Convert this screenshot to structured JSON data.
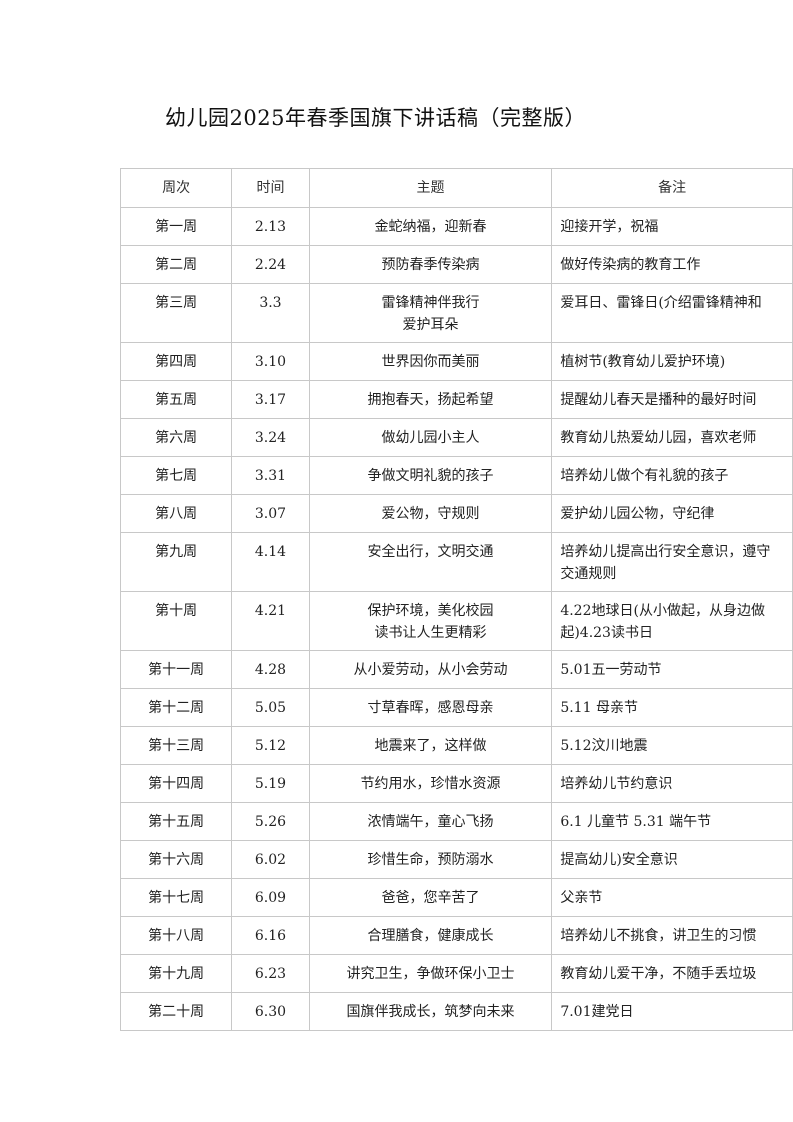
{
  "document": {
    "title": "幼儿园2025年春季国旗下讲话稿（完整版）"
  },
  "table": {
    "headers": {
      "week": "周次",
      "date": "时间",
      "theme": "主题",
      "note": "备注"
    },
    "rows": [
      {
        "week": "第一周",
        "date": "2.13",
        "theme": [
          "金蛇纳福，迎新春"
        ],
        "note": "迎接开学，祝福"
      },
      {
        "week": "第二周",
        "date": "2.24",
        "theme": [
          "预防春季传染病"
        ],
        "note": "做好传染病的教育工作"
      },
      {
        "week": "第三周",
        "date": "3.3",
        "theme": [
          "雷锋精神伴我行",
          "爱护耳朵"
        ],
        "note": "爱耳日、雷锋日(介绍雷锋精神和"
      },
      {
        "week": "第四周",
        "date": "3.10",
        "theme": [
          "世界因你而美丽"
        ],
        "note": "植树节(教育幼儿爱护环境)"
      },
      {
        "week": "第五周",
        "date": "3.17",
        "theme": [
          "拥抱春天，扬起希望"
        ],
        "note": "提醒幼儿春天是播种的最好时间"
      },
      {
        "week": "第六周",
        "date": "3.24",
        "theme": [
          "做幼儿园小主人"
        ],
        "note": "教育幼儿热爱幼儿园，喜欢老师"
      },
      {
        "week": "第七周",
        "date": "3.31",
        "theme": [
          "争做文明礼貌的孩子"
        ],
        "note": "培养幼儿做个有礼貌的孩子"
      },
      {
        "week": "第八周",
        "date": "3.07",
        "theme": [
          "爱公物，守规则"
        ],
        "note": "爱护幼儿园公物，守纪律"
      },
      {
        "week": "第九周",
        "date": "4.14",
        "theme": [
          "安全出行，文明交通"
        ],
        "note": "培养幼儿提高出行安全意识，遵守交通规则"
      },
      {
        "week": "第十周",
        "date": "4.21",
        "theme": [
          "保护环境，美化校园",
          "读书让人生更精彩"
        ],
        "note": "4.22地球日(从小做起，从身边做起)4.23读书日"
      },
      {
        "week": "第十一周",
        "date": "4.28",
        "theme": [
          "从小爱劳动，从小会劳动"
        ],
        "note": "5.01五一劳动节"
      },
      {
        "week": "第十二周",
        "date": "5.05",
        "theme": [
          "寸草春晖，感恩母亲"
        ],
        "note": "5.11 母亲节"
      },
      {
        "week": "第十三周",
        "date": "5.12",
        "theme": [
          "地震来了，这样做"
        ],
        "note": "5.12汶川地震"
      },
      {
        "week": "第十四周",
        "date": "5.19",
        "theme": [
          "节约用水，珍惜水资源"
        ],
        "note": "培养幼儿节约意识"
      },
      {
        "week": "第十五周",
        "date": "5.26",
        "theme": [
          "浓情端午，童心飞扬"
        ],
        "note": "6.1 儿童节 5.31 端午节"
      },
      {
        "week": "第十六周",
        "date": "6.02",
        "theme": [
          "珍惜生命，预防溺水"
        ],
        "note": "提高幼儿)安全意识"
      },
      {
        "week": "第十七周",
        "date": "6.09",
        "theme": [
          "爸爸，您辛苦了"
        ],
        "note": "父亲节"
      },
      {
        "week": "第十八周",
        "date": "6.16",
        "theme": [
          "合理膳食，健康成长"
        ],
        "note": "培养幼儿不挑食，讲卫生的习惯"
      },
      {
        "week": "第十九周",
        "date": "6.23",
        "theme": [
          "讲究卫生，争做环保小卫士"
        ],
        "note": "教育幼儿爱干净，不随手丢垃圾"
      },
      {
        "week": "第二十周",
        "date": "6.30",
        "theme": [
          "国旗伴我成长，筑梦向未来"
        ],
        "note": "7.01建党日"
      }
    ]
  }
}
